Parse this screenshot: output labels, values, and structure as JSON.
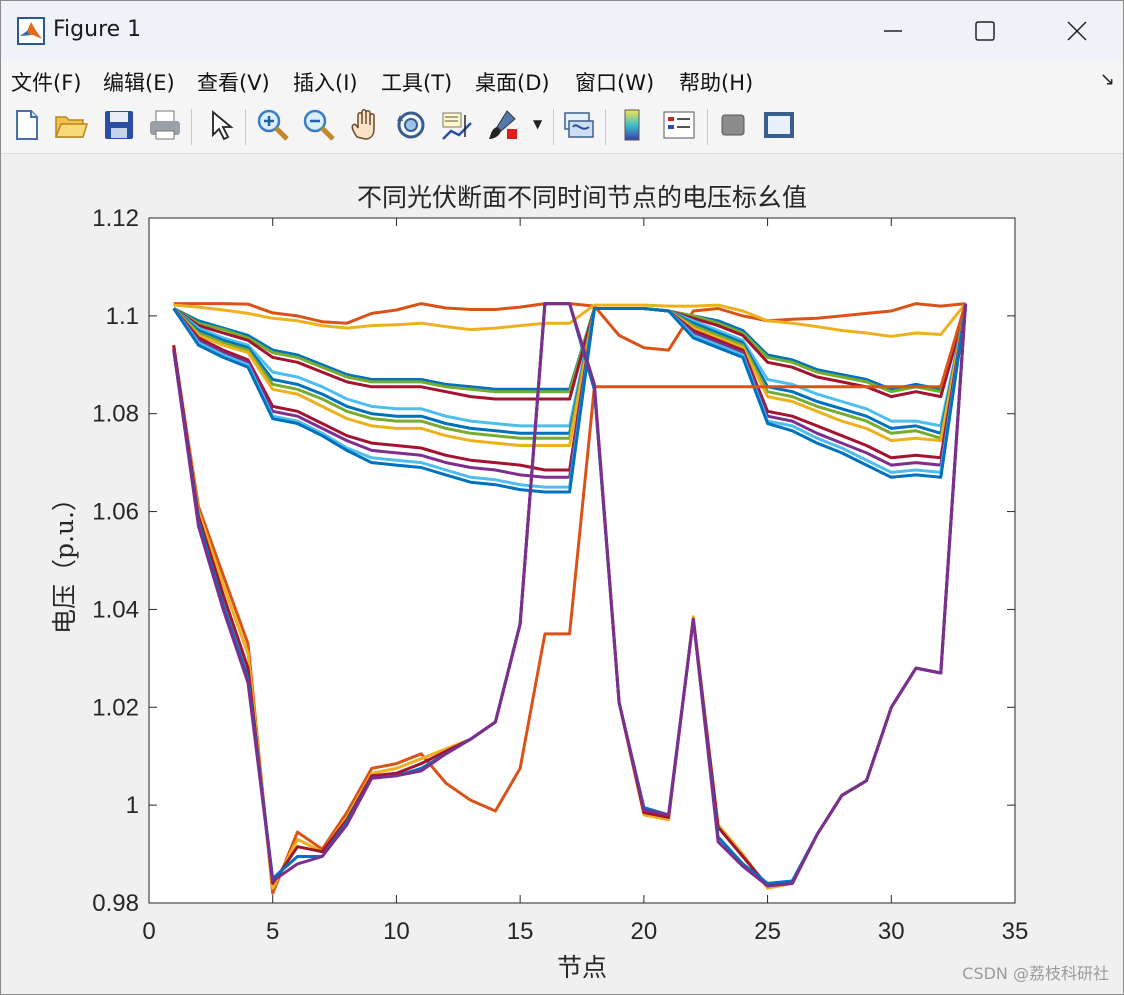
{
  "window": {
    "title": "Figure 1",
    "menu": [
      "文件(F)",
      "编辑(E)",
      "查看(V)",
      "插入(I)",
      "工具(T)",
      "桌面(D)",
      "窗口(W)",
      "帮助(H)"
    ]
  },
  "toolbar": {
    "buttons": [
      "new-figure-icon",
      "open-file-icon",
      "save-icon",
      "print-icon",
      "pointer-icon",
      "zoom-in-icon",
      "zoom-out-icon",
      "pan-hand-icon",
      "rotate-3d-icon",
      "data-cursor-icon",
      "brush-icon",
      "link-plot-icon",
      "colorbar-icon",
      "legend-icon",
      "hide-plot-tools-icon",
      "show-plot-tools-icon"
    ]
  },
  "chart_data": {
    "type": "line",
    "title": "不同光伏断面不同时间节点的电压标幺值",
    "xlabel": "节点",
    "ylabel": "电压（p.u.）",
    "xlim": [
      0,
      35
    ],
    "ylim": [
      0.98,
      1.12
    ],
    "xticks": [
      "0",
      "5",
      "10",
      "15",
      "20",
      "25",
      "30",
      "35"
    ],
    "yticks": [
      "0.98",
      "1",
      "1.02",
      "1.04",
      "1.06",
      "1.08",
      "1.1",
      "1.12"
    ],
    "grid": false,
    "x": [
      1,
      2,
      3,
      4,
      5,
      6,
      7,
      8,
      9,
      10,
      11,
      12,
      13,
      14,
      15,
      16,
      17,
      18,
      19,
      20,
      21,
      22,
      23,
      24,
      25,
      26,
      27,
      28,
      29,
      30,
      31,
      32,
      33
    ],
    "series": [
      {
        "color": "#d95319",
        "values": [
          1.1025,
          1.1025,
          1.1025,
          1.1024,
          1.1006,
          1.1,
          1.0988,
          1.0985,
          1.1005,
          1.1012,
          1.1025,
          1.1016,
          1.1013,
          1.1013,
          1.1018,
          1.1025,
          1.1025,
          1.102,
          1.096,
          1.0935,
          1.093,
          1.101,
          1.1015,
          1.1,
          1.099,
          1.0993,
          1.0995,
          1.1,
          1.1005,
          1.101,
          1.1025,
          1.102,
          1.1025
        ]
      },
      {
        "color": "#edb120",
        "values": [
          1.1022,
          1.1018,
          1.1012,
          1.1005,
          1.0995,
          1.099,
          1.098,
          1.0975,
          1.098,
          1.0982,
          1.0985,
          1.0978,
          1.0972,
          1.0975,
          1.098,
          1.0985,
          1.0985,
          1.1022,
          1.1022,
          1.1022,
          1.102,
          1.102,
          1.1022,
          1.101,
          1.099,
          1.0985,
          1.0978,
          1.097,
          1.0965,
          1.0958,
          1.0965,
          1.0962,
          1.1025
        ]
      },
      {
        "color": "#0072bd",
        "values": [
          1.1015,
          1.099,
          1.0975,
          1.096,
          1.093,
          1.092,
          1.09,
          1.088,
          1.087,
          1.087,
          1.087,
          1.086,
          1.0855,
          1.085,
          1.085,
          1.085,
          1.085,
          1.1015,
          1.1015,
          1.1015,
          1.101,
          1.1,
          1.099,
          1.097,
          1.092,
          1.091,
          1.089,
          1.088,
          1.087,
          1.085,
          1.086,
          1.085,
          1.1015
        ]
      },
      {
        "color": "#77ac30",
        "values": [
          1.1015,
          1.0985,
          1.0972,
          1.0955,
          1.0925,
          1.0915,
          1.0895,
          1.0875,
          1.0865,
          1.0865,
          1.0865,
          1.0855,
          1.085,
          1.0845,
          1.0845,
          1.0845,
          1.0845,
          1.1015,
          1.1015,
          1.1015,
          1.101,
          1.1,
          1.0985,
          1.0965,
          1.0915,
          1.0905,
          1.0885,
          1.0875,
          1.0865,
          1.0845,
          1.0855,
          1.0845,
          1.1015
        ]
      },
      {
        "color": "#a2142f",
        "values": [
          1.1015,
          1.098,
          1.0965,
          1.095,
          1.0915,
          1.0905,
          1.0885,
          1.0865,
          1.0855,
          1.0855,
          1.0855,
          1.0845,
          1.0835,
          1.083,
          1.083,
          1.083,
          1.083,
          1.1015,
          1.1015,
          1.1015,
          1.101,
          1.0995,
          1.098,
          1.096,
          1.0905,
          1.0895,
          1.0875,
          1.0865,
          1.0855,
          1.0835,
          1.0845,
          1.0835,
          1.1015
        ]
      },
      {
        "color": "#4dbeee",
        "values": [
          1.1015,
          1.0975,
          1.0955,
          1.094,
          1.0885,
          1.0875,
          1.0855,
          1.083,
          1.0815,
          1.081,
          1.081,
          1.0795,
          1.0785,
          1.078,
          1.0775,
          1.0775,
          1.0775,
          1.1015,
          1.1015,
          1.1015,
          1.101,
          1.099,
          1.097,
          1.095,
          1.087,
          1.086,
          1.084,
          1.0825,
          1.081,
          1.0785,
          1.0785,
          1.0775,
          1.1015
        ]
      },
      {
        "color": "#0072bd",
        "values": [
          1.1015,
          1.097,
          1.095,
          1.0935,
          1.087,
          1.086,
          1.084,
          1.0815,
          1.08,
          1.0795,
          1.0795,
          1.078,
          1.077,
          1.0765,
          1.076,
          1.076,
          1.076,
          1.1015,
          1.1015,
          1.1015,
          1.101,
          1.0985,
          1.0965,
          1.0945,
          1.0855,
          1.0845,
          1.0825,
          1.081,
          1.0795,
          1.077,
          1.0775,
          1.076,
          1.1015
        ]
      },
      {
        "color": "#77ac30",
        "values": [
          1.1015,
          1.0965,
          1.0945,
          1.093,
          1.086,
          1.085,
          1.083,
          1.0805,
          1.079,
          1.0785,
          1.0785,
          1.077,
          1.076,
          1.0755,
          1.075,
          1.075,
          1.075,
          1.1015,
          1.1015,
          1.1015,
          1.101,
          1.098,
          1.096,
          1.094,
          1.0845,
          1.0835,
          1.0815,
          1.08,
          1.0785,
          1.076,
          1.0765,
          1.075,
          1.1015
        ]
      },
      {
        "color": "#edb120",
        "values": [
          1.1015,
          1.096,
          1.094,
          1.0925,
          1.085,
          1.084,
          1.0815,
          1.079,
          1.0775,
          1.077,
          1.077,
          1.0755,
          1.0745,
          1.074,
          1.0735,
          1.0735,
          1.0735,
          1.1015,
          1.1015,
          1.1015,
          1.101,
          1.0975,
          1.0955,
          1.0935,
          1.0835,
          1.0825,
          1.0805,
          1.0785,
          1.077,
          1.0745,
          1.075,
          1.0745,
          1.1015
        ]
      },
      {
        "color": "#a2142f",
        "values": [
          1.1015,
          1.0955,
          1.093,
          1.091,
          1.0815,
          1.0805,
          1.078,
          1.0755,
          1.074,
          1.0735,
          1.073,
          1.0715,
          1.0705,
          1.07,
          1.0695,
          1.0685,
          1.0685,
          1.1015,
          1.1015,
          1.1015,
          1.101,
          1.097,
          1.095,
          1.093,
          1.0805,
          1.0795,
          1.0775,
          1.0755,
          1.0735,
          1.071,
          1.0715,
          1.071,
          1.1015
        ]
      },
      {
        "color": "#7e2f8e",
        "values": [
          1.1015,
          1.095,
          1.0925,
          1.0905,
          1.0805,
          1.0795,
          1.077,
          1.0745,
          1.0725,
          1.072,
          1.0715,
          1.07,
          1.069,
          1.0685,
          1.0675,
          1.067,
          1.067,
          1.1015,
          1.1015,
          1.1015,
          1.101,
          1.0965,
          1.0945,
          1.0925,
          1.0795,
          1.0785,
          1.076,
          1.074,
          1.072,
          1.0695,
          1.07,
          1.0695,
          1.1015
        ]
      },
      {
        "color": "#4dbeee",
        "values": [
          1.1015,
          1.0945,
          1.092,
          1.09,
          1.0795,
          1.0785,
          1.076,
          1.073,
          1.071,
          1.0705,
          1.07,
          1.0685,
          1.067,
          1.0665,
          1.0655,
          1.065,
          1.065,
          1.1015,
          1.1015,
          1.1015,
          1.101,
          1.096,
          1.094,
          1.092,
          1.0785,
          1.0775,
          1.075,
          1.073,
          1.0705,
          1.068,
          1.0685,
          1.068,
          1.1015
        ]
      },
      {
        "color": "#0072bd",
        "values": [
          1.1015,
          1.094,
          1.0915,
          1.0895,
          1.079,
          1.078,
          1.0755,
          1.0725,
          1.07,
          1.0695,
          1.069,
          1.0675,
          1.066,
          1.0655,
          1.0645,
          1.064,
          1.064,
          1.1015,
          1.1015,
          1.1015,
          1.101,
          1.0955,
          1.0935,
          1.0915,
          1.078,
          1.0765,
          1.074,
          1.072,
          1.0695,
          1.067,
          1.0675,
          1.067,
          1.1015
        ]
      },
      {
        "color": "#d95319",
        "values": [
          1.0935,
          1.061,
          1.047,
          1.033,
          0.982,
          0.9945,
          0.991,
          0.9985,
          1.0075,
          1.0085,
          1.0105,
          1.0045,
          1.001,
          0.9988,
          1.0075,
          1.035,
          1.035,
          1.0855,
          1.0855,
          1.0855,
          1.0855,
          1.0855,
          1.0855,
          1.0855,
          1.0855,
          1.0855,
          1.0855,
          1.0855,
          1.0855,
          1.0855,
          1.0855,
          1.0855,
          1.1025
        ]
      },
      {
        "color": "#edb120",
        "values": [
          1.094,
          1.06,
          1.045,
          1.031,
          0.983,
          0.993,
          0.9905,
          0.9975,
          1.0065,
          1.0075,
          1.0095,
          1.0115,
          1.0135,
          1.017,
          1.037,
          1.1025,
          1.1025,
          1.085,
          1.021,
          0.998,
          0.997,
          1.0385,
          0.996,
          0.99,
          0.983,
          0.984,
          0.994,
          1.002,
          1.005,
          1.02,
          1.028,
          1.027,
          1.1025
        ]
      },
      {
        "color": "#a2142f",
        "values": [
          1.094,
          1.059,
          1.043,
          1.028,
          0.984,
          0.9915,
          0.9905,
          0.997,
          1.006,
          1.0065,
          1.0085,
          1.011,
          1.0135,
          1.017,
          1.037,
          1.1025,
          1.1025,
          1.085,
          1.021,
          0.9985,
          0.9975,
          1.038,
          0.9955,
          0.9895,
          0.9835,
          0.984,
          0.994,
          1.002,
          1.005,
          1.02,
          1.028,
          1.027,
          1.1025
        ]
      },
      {
        "color": "#0072bd",
        "values": [
          1.093,
          1.058,
          1.041,
          1.026,
          0.985,
          0.9895,
          0.9895,
          0.9965,
          1.0055,
          1.006,
          1.0075,
          1.0105,
          1.0135,
          1.017,
          1.037,
          1.1025,
          1.1025,
          1.085,
          1.021,
          0.9995,
          0.998,
          1.038,
          0.9935,
          0.988,
          0.984,
          0.9845,
          0.994,
          1.002,
          1.005,
          1.02,
          1.028,
          1.027,
          1.1025
        ]
      },
      {
        "color": "#7e2f8e",
        "values": [
          1.093,
          1.057,
          1.04,
          1.025,
          0.9845,
          0.988,
          0.9895,
          0.996,
          1.0055,
          1.006,
          1.007,
          1.0105,
          1.0135,
          1.017,
          1.037,
          1.1025,
          1.1025,
          1.086,
          1.021,
          0.999,
          0.998,
          1.038,
          0.9925,
          0.9875,
          0.9835,
          0.984,
          0.994,
          1.002,
          1.005,
          1.02,
          1.028,
          1.027,
          1.1025
        ]
      }
    ]
  },
  "watermark": "CSDN @荔枝科研社"
}
